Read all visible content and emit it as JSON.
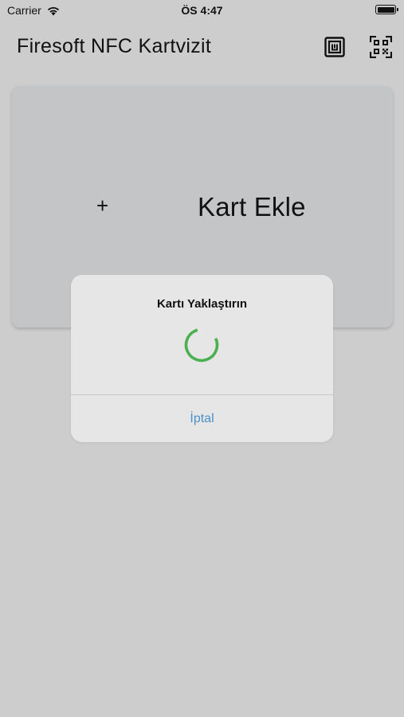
{
  "status_bar": {
    "carrier": "Carrier",
    "time": "ÖS 4:47"
  },
  "app_bar": {
    "title": "Firesoft NFC Kartvizit",
    "actions": [
      {
        "icon": "nfc-icon"
      },
      {
        "icon": "qr-code-icon"
      }
    ]
  },
  "card": {
    "plus": "+",
    "label": "Kart Ekle"
  },
  "dialog": {
    "title": "Kartı Yaklaştırın",
    "spinner_color": "#4caf50",
    "cancel_label": "İptal"
  },
  "colors": {
    "background": "#cdcdcd",
    "card": "#c4c5c7",
    "dialog": "#e6e6e6",
    "link": "#4a90c9"
  }
}
